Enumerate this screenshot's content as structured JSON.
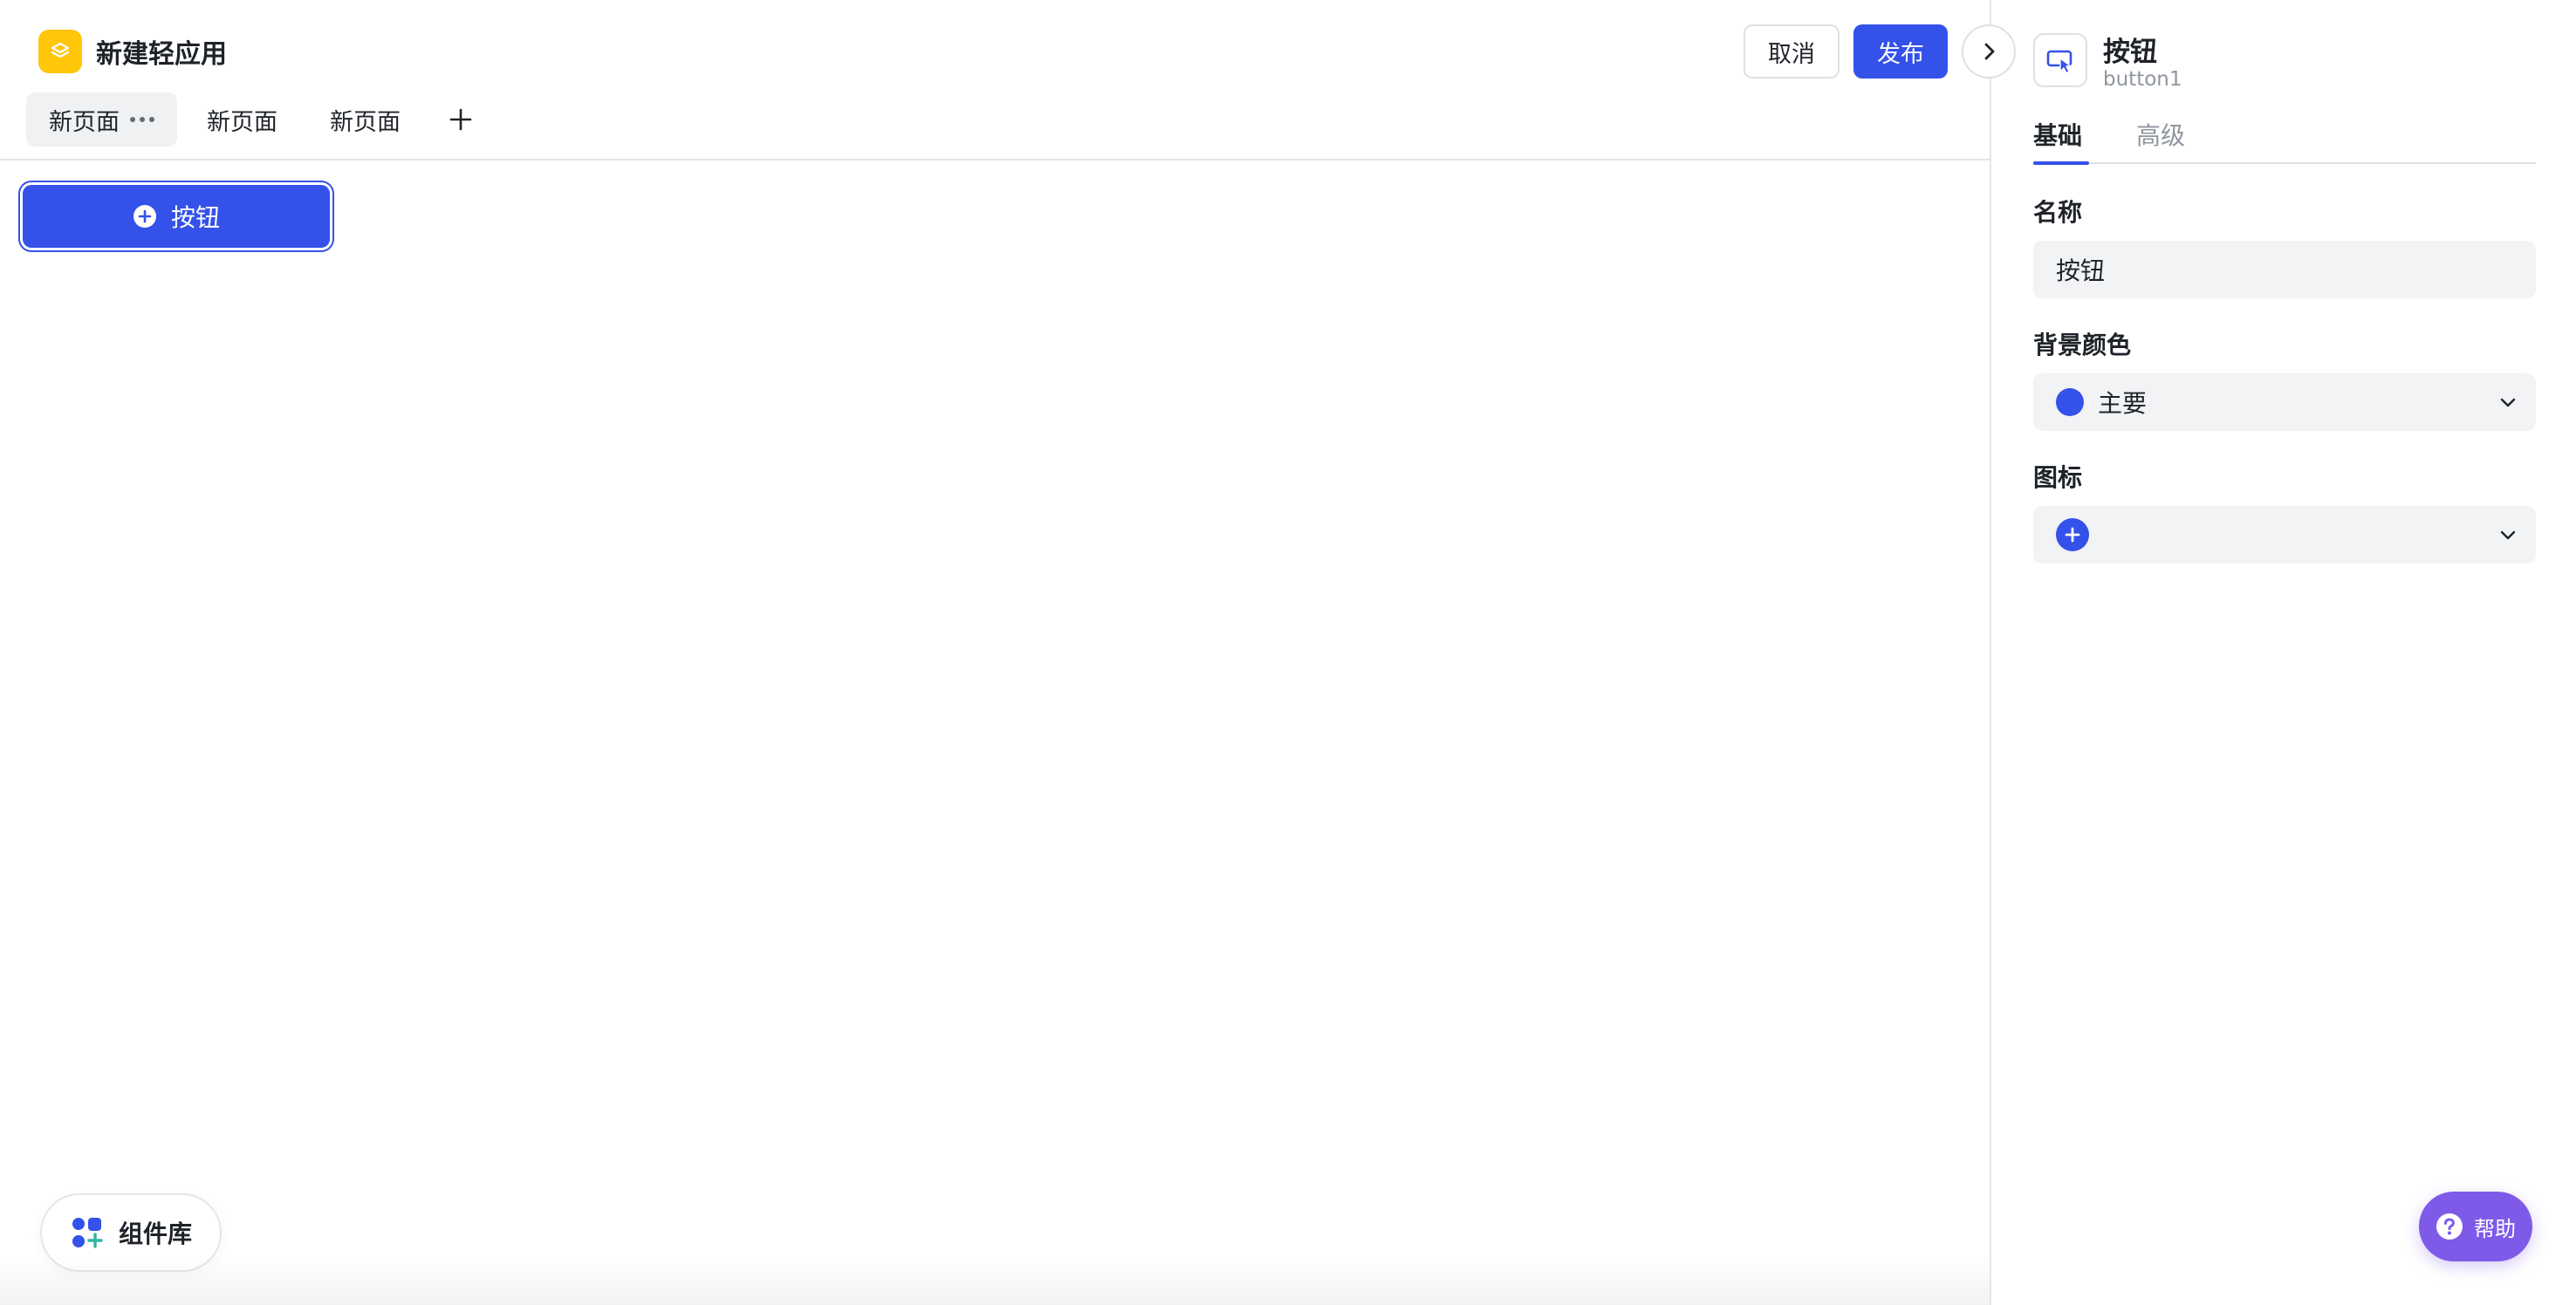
{
  "app": {
    "title": "新建轻应用",
    "logo_icon": "layers-icon"
  },
  "tabs": [
    {
      "label": "新页面",
      "active": true
    },
    {
      "label": "新页面",
      "active": false
    },
    {
      "label": "新页面",
      "active": false
    }
  ],
  "toolbar": {
    "cancel_label": "取消",
    "publish_label": "发布"
  },
  "canvas": {
    "button_label": "按钮",
    "button_icon": "plus-circle-icon"
  },
  "component_library": {
    "label": "组件库",
    "icon": "components-add-icon"
  },
  "panel": {
    "component_name": "按钮",
    "component_id": "button1",
    "component_icon": "cursor-button-icon",
    "tabs": [
      "基础",
      "高级"
    ],
    "fields": {
      "name": {
        "label": "名称",
        "value": "按钮"
      },
      "background_color": {
        "label": "背景颜色",
        "value": "主要",
        "color": "#3451e9"
      },
      "icon": {
        "label": "图标",
        "value_icon": "plus-circle-icon"
      }
    }
  },
  "help": {
    "label": "帮助",
    "icon": "question-circle-icon"
  },
  "colors": {
    "primary": "#3451e9",
    "logo": "#ffc60a",
    "help": "#7f5ae8"
  }
}
